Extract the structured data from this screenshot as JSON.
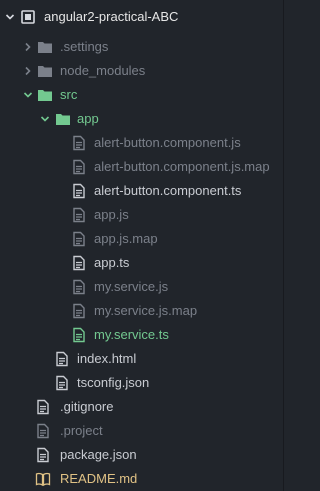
{
  "tree": {
    "root": {
      "label": "angular2-practical-ABC"
    },
    "items": [
      {
        "label": ".settings",
        "kind": "folder",
        "state": "collapsed",
        "status": "ignored"
      },
      {
        "label": "node_modules",
        "kind": "folder",
        "state": "collapsed",
        "status": "ignored"
      },
      {
        "label": "src",
        "kind": "folder",
        "state": "expanded",
        "status": "added"
      },
      {
        "label": "app",
        "kind": "folder",
        "state": "expanded",
        "status": "added"
      },
      {
        "label": "alert-button.component.js",
        "kind": "file",
        "status": "ignored"
      },
      {
        "label": "alert-button.component.js.map",
        "kind": "file",
        "status": "ignored"
      },
      {
        "label": "alert-button.component.ts",
        "kind": "file",
        "status": "normal"
      },
      {
        "label": "app.js",
        "kind": "file",
        "status": "ignored"
      },
      {
        "label": "app.js.map",
        "kind": "file",
        "status": "ignored"
      },
      {
        "label": "app.ts",
        "kind": "file",
        "status": "normal"
      },
      {
        "label": "my.service.js",
        "kind": "file",
        "status": "ignored"
      },
      {
        "label": "my.service.js.map",
        "kind": "file",
        "status": "ignored"
      },
      {
        "label": "my.service.ts",
        "kind": "file",
        "status": "added"
      },
      {
        "label": "index.html",
        "kind": "file",
        "status": "normal"
      },
      {
        "label": "tsconfig.json",
        "kind": "file",
        "status": "normal"
      },
      {
        "label": ".gitignore",
        "kind": "file",
        "status": "normal"
      },
      {
        "label": ".project",
        "kind": "file",
        "status": "ignored"
      },
      {
        "label": "package.json",
        "kind": "file",
        "status": "normal"
      },
      {
        "label": "README.md",
        "kind": "book-file",
        "status": "modified"
      }
    ]
  },
  "colors": {
    "background": "#21252b",
    "text_normal": "#c9ccd2",
    "text_ignored": "#7b808a",
    "text_added": "#73c990",
    "text_modified": "#e0c285"
  },
  "icons": {
    "chevron_expanded": "chevron-down-icon",
    "chevron_collapsed": "chevron-right-icon",
    "folder": "folder-icon",
    "file": "file-text-icon",
    "book": "book-icon"
  }
}
